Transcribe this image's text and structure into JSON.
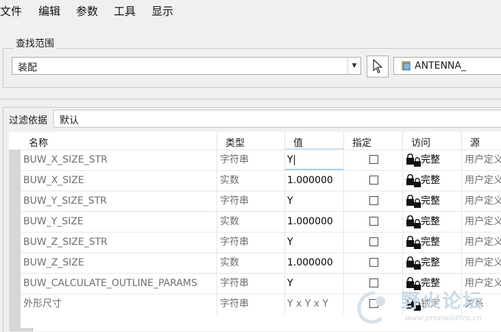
{
  "menu": {
    "items": [
      "文件",
      "编辑",
      "参数",
      "工具",
      "显示"
    ]
  },
  "lookup": {
    "legend": "查找范围",
    "scope_value": "装配",
    "model_name": "ANTENNA_"
  },
  "filter": {
    "label": "过滤依据",
    "value": "默认"
  },
  "table": {
    "headers": {
      "name": "名称",
      "type": "类型",
      "value": "值",
      "designate": "指定",
      "access": "访问",
      "source": "源"
    },
    "rows": [
      {
        "name": "BUW_X_SIZE_STR",
        "type": "字符串",
        "value": "Y",
        "access": "完整",
        "source": "用户定义的"
      },
      {
        "name": "BUW_X_SIZE",
        "type": "实数",
        "value": "1.000000",
        "access": "完整",
        "source": "用户定义的"
      },
      {
        "name": "BUW_Y_SIZE_STR",
        "type": "字符串",
        "value": "Y",
        "access": "完整",
        "source": "用户定义的"
      },
      {
        "name": "BUW_Y_SIZE",
        "type": "实数",
        "value": "1.000000",
        "access": "完整",
        "source": "用户定义的"
      },
      {
        "name": "BUW_Z_SIZE_STR",
        "type": "字符串",
        "value": "Y",
        "access": "完整",
        "source": "用户定义的"
      },
      {
        "name": "BUW_Z_SIZE",
        "type": "实数",
        "value": "1.000000",
        "access": "完整",
        "source": "用户定义的"
      },
      {
        "name": "BUW_CALCULATE_OUTLINE_PARAMS",
        "type": "字符串",
        "value": "Y",
        "access": "完整",
        "source": "用户定义的"
      },
      {
        "name": "外形尺寸",
        "type": "字符串",
        "value": "Y x Y x Y",
        "access": "锁定",
        "source": "关系"
      }
    ]
  },
  "watermark": {
    "title": "野火论坛",
    "url": "www.proewildfire.cn"
  },
  "icons": {
    "pointer": "cursor-arrow-icon",
    "model": "assembly-icon",
    "lock": "lock-icon",
    "dropdown": "chevron-down-icon"
  },
  "colors": {
    "edit_accent": "#a8d0e8",
    "grid_header_strip": "#d6d6d6"
  }
}
